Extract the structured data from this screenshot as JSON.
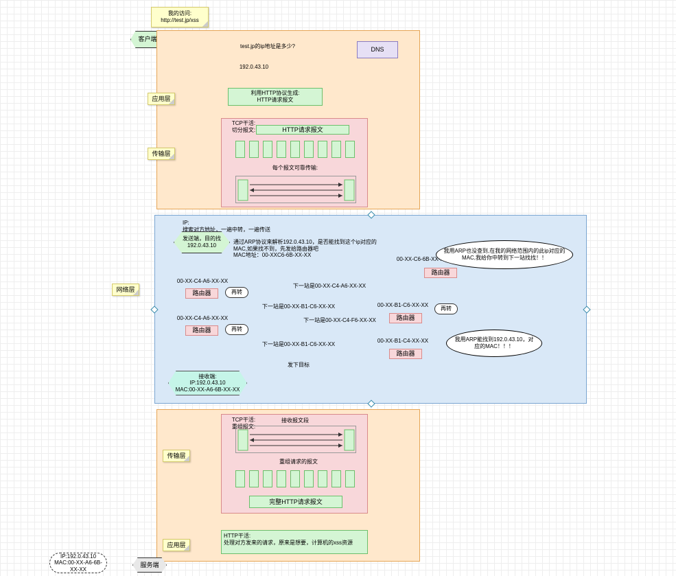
{
  "title_note": {
    "line1": "我的访问:",
    "line2": "http://test.jp/xss"
  },
  "client_hex": "客户端",
  "dns_arrow1": "test.jp的ip地址是多少?",
  "dns_arrow2": "192.0.43.10",
  "dns_box": "DNS",
  "layer_labels": {
    "app_top": "应用层",
    "transport_top": "传输层",
    "network": "网络层",
    "transport_bottom": "传输层",
    "app_bottom": "应用层"
  },
  "app_top": {
    "label": "利用HTTP协议生成:",
    "content": "HTTP请求报文"
  },
  "tcp_top": {
    "label": "TCP干活:\n切分报文:",
    "http_msg": "HTTP请求报文",
    "note": "每个报文可靠传输:"
  },
  "ip_header": "IP:\n搜索对方地址，一遍中转，一遍传送",
  "sender_hex": "发送端，目的找\n192.0.43.10",
  "arp_text": "通过ARP协议来解析192.0.43.10，是否能找到这个ip对应的MAC,如果找不到，先发给路由器吧\nMAC地址：00-XXC6-6B-XX-XX",
  "routers": {
    "r1": "路由器",
    "r2": "路由器",
    "r3": "路由器",
    "r4": "路由器",
    "r5": "路由器"
  },
  "mac": {
    "m1": "00-XX-C6-6B-XX-XX",
    "m2": "00-XX-C4-A6-XX-XX",
    "m3": "00-XX-C4-A6-XX-XX",
    "m4": "00-XX-B1-C6-XX-XX",
    "m5": "00-XX-B1-C4-XX-XX"
  },
  "hop": {
    "h1": "下一站是00-XX-C4-A6-XX-XX",
    "h2": "下一站是00-XX-B1-C6-XX-XX",
    "h3": "下一站是00-XX-C4-F6-XX-XX",
    "h4": "下一站是00-XX-B1-C6-XX-XX",
    "h5": "发下目标"
  },
  "retransmit": "再转",
  "bubble1": "我用ARP也没查到,在我的网络范围内的此ip对应的MAC,我给你中转到下一站找找！！",
  "bubble2": "我用ARP能找到192.0.43.10，对应的MAC！！！",
  "receiver_hex": "接收端:\nIP:192.0.43.10\nMAC:00-XX-A6-6B-XX-XX",
  "tcp_bottom": {
    "label": "TCP干活:\n重组报文:",
    "recv": "接收报文段",
    "rebuild": "重组请求的报文",
    "complete": "完整HTTP请求报文"
  },
  "http_bottom": "HTTP干活:\n处理对方发来的请求，原来是想要，计算机的xss资源",
  "server_hex": "服务端",
  "server_info": "IP:192.0.43.10\nMAC:00-XX-A6-6B-XX-XX"
}
